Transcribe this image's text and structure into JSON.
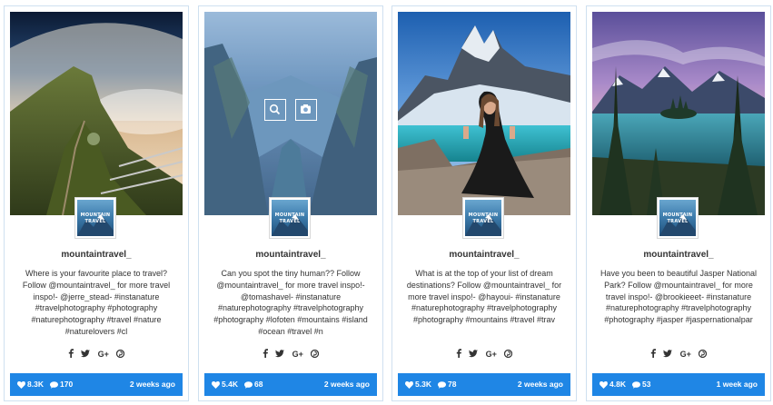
{
  "cards": [
    {
      "username": "mountaintravel_",
      "caption": "Where is your favourite place to travel? Follow @mountaintravel_ for more travel inspo!- @jerre_stead- #instanature #travelphotography #photography #naturephotography #travel #nature #naturelovers #cl",
      "likes": "8.3K",
      "comments": "170",
      "time_ago": "2 weeks ago"
    },
    {
      "username": "mountaintravel_",
      "caption": "Can you spot the tiny human?? Follow @mountaintravel_ for more travel inspo!- @tomashavel- #instanature #naturephotography #travelphotography #photography #lofoten #mountains #island #ocean #travel #n",
      "likes": "5.4K",
      "comments": "68",
      "time_ago": "2 weeks ago"
    },
    {
      "username": "mountaintravel_",
      "caption": "What is at the top of your list of dream destinations? Follow @mountaintravel_ for more travel inspo!- @hayoui- #instanature #naturephotography #travelphotography #photography #mountains #travel #trav",
      "likes": "5.3K",
      "comments": "78",
      "time_ago": "2 weeks ago"
    },
    {
      "username": "mountaintravel_",
      "caption": "Have you been to beautiful Jasper National Park? Follow @mountaintravel_ for more travel inspo!- @brookieeet- #instanature #naturephotography #travelphotography #photography #jasper #jaspernationalpar",
      "likes": "4.8K",
      "comments": "53",
      "time_ago": "1 week ago"
    }
  ],
  "avatar_logo": {
    "line1": "MOUNTAIN",
    "line2": "TRAVEL"
  },
  "social_icons": [
    "facebook-icon",
    "twitter-icon",
    "google-plus-icon",
    "pinterest-icon"
  ],
  "google_plus_label": "G+",
  "colors": {
    "stat_bar": "#1f86e5",
    "card_border": "#cfe0f0"
  }
}
